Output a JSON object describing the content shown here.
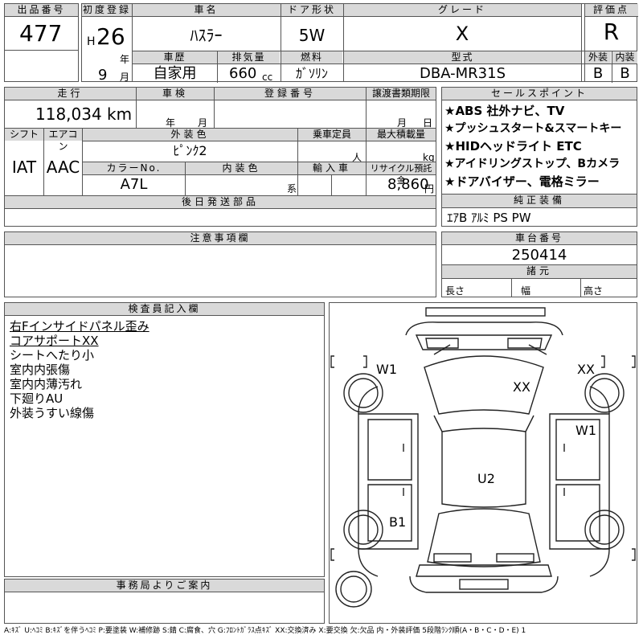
{
  "header": {
    "lot_label": "出品番号",
    "lot": "477",
    "first_reg_label": "初度登録",
    "era": "H",
    "year": "26",
    "year_unit": "年",
    "month": "9",
    "month_unit": "月",
    "car_name_label": "車名",
    "car_name": "ﾊｽﾗｰ",
    "door_label": "ドア形状",
    "door": "5W",
    "grade_label": "グレード",
    "grade": "X",
    "rating_label": "評価点",
    "rating": "R",
    "history_label": "車歴",
    "history": "自家用",
    "displacement_label": "排気量",
    "displacement": "660",
    "displacement_unit": "cc",
    "fuel_label": "燃料",
    "fuel": "ｶﾞｿﾘﾝ",
    "model_code_label": "型式",
    "model_code": "DBA-MR31S",
    "exterior_label": "外装",
    "exterior": "B",
    "interior_label": "内装",
    "interior": "B"
  },
  "row2": {
    "mileage_label": "走行",
    "mileage": "118,034",
    "mileage_unit": "km",
    "inspection_label": "車検",
    "insp_year_unit": "年",
    "insp_month_unit": "月",
    "plate_label": "登録番号",
    "transfer_label": "譲渡書類期限",
    "transfer_month_unit": "月",
    "transfer_day_unit": "日",
    "shift_label": "シフト",
    "shift": "IAT",
    "ac_label": "エアコン",
    "ac": "AAC",
    "ext_color_label": "外装色",
    "ext_color": "ﾋﾟﾝｸ2",
    "capacity_label": "乗車定員",
    "capacity_unit": "人",
    "load_label": "最大積載量",
    "load_unit": "kg",
    "color_no_label": "カラーNo.",
    "color_no": "A7L",
    "int_color_label": "内装色",
    "int_color_unit": "系",
    "import_label": "輸入車",
    "recycle_label": "リサイクル預託金",
    "recycle": "8,860",
    "recycle_unit": "円",
    "later_parts_label": "後日発送部品"
  },
  "sales_points": {
    "label": "セールスポイント",
    "lines": [
      "★ABS 社外ナビ、TV",
      "★プッシュスタート&スマートキー",
      "★HIDヘッドライト ETC",
      "★アイドリングストップ、Bカメラ",
      "★ドアバイザー、電格ミラー"
    ]
  },
  "equipment": {
    "label": "純正装備",
    "value": "ｴｱB ｱﾙﾐ PS PW"
  },
  "caution": {
    "label": "注意事項欄"
  },
  "chassis": {
    "label": "車台番号",
    "value": "250414"
  },
  "specs": {
    "label": "諸元",
    "length": "長さ",
    "width": "幅",
    "height": "高さ"
  },
  "inspector": {
    "label": "検査員記入欄",
    "notes": [
      "右Fインサイドパネル歪み",
      "コアサポートXX",
      "シートへたり小",
      "室内内張傷",
      "室内内薄汚れ",
      "下廻りAU",
      "外装うすい線傷"
    ]
  },
  "office": {
    "label": "事務局よりご案内"
  },
  "diagram_marks": {
    "w1_left": "W1",
    "xx_top": "XX",
    "xx_right": "XX",
    "w1_right": "W1",
    "u2": "U2",
    "b1": "B1"
  },
  "legend": "A:ｷｽﾞ U:ﾍｺﾐ B:ｷｽﾞを伴うﾍｺﾐ P:要塗装 W:補修跡 S:錆 C:腐食、穴 G:ﾌﾛﾝﾄｶﾞﾗｽ点ｷｽﾞ XX:交換済み X:要交換 欠:欠品 内・外装評価 5段階ﾗﾝｸ順(A・B・C・D・E) 1"
}
